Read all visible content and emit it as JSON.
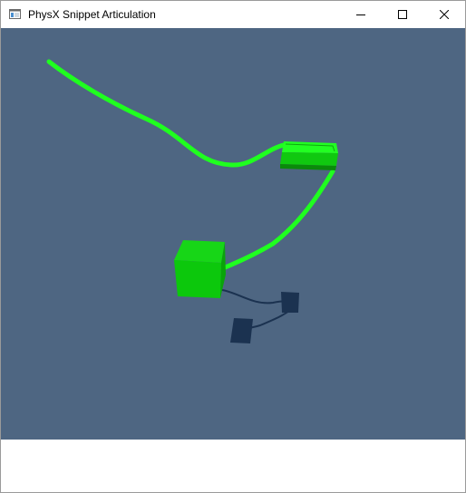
{
  "window": {
    "title": "PhysX Snippet Articulation",
    "icon": "app-window-icon",
    "controls": {
      "minimize": "minimize-icon",
      "maximize": "maximize-icon",
      "close": "close-icon"
    }
  },
  "scene": {
    "background_color": "#4e6682",
    "rope_color": "#1fff1f",
    "box_color": "#0cc80c",
    "shadow_color": "#1b3250"
  }
}
